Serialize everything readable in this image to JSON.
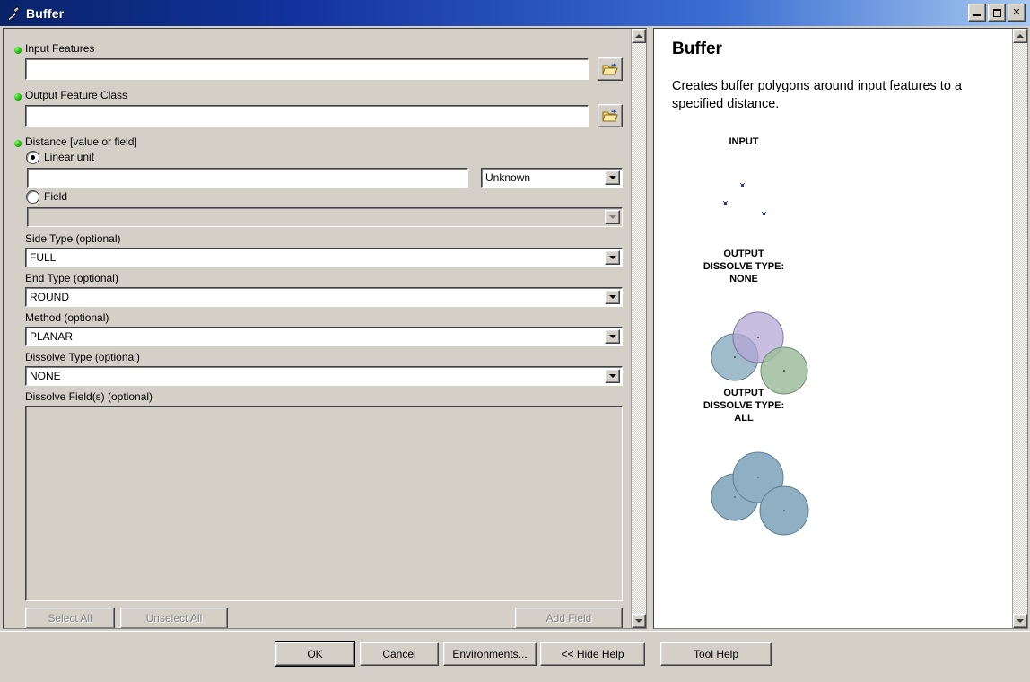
{
  "window": {
    "title": "Buffer",
    "icon": "hammer-tool-icon",
    "minimize_label": "Minimize",
    "maximize_label": "Maximize",
    "close_label": "✕"
  },
  "parameters": {
    "input_features": {
      "label": "Input Features",
      "value": "",
      "required": true,
      "browse_label": "Browse"
    },
    "output_feature_class": {
      "label": "Output Feature Class",
      "value": "",
      "required": true,
      "browse_label": "Browse"
    },
    "distance": {
      "label": "Distance [value or field]",
      "required": true,
      "linear_unit_option": "Linear unit",
      "linear_unit_value": "",
      "unit_value": "Unknown",
      "field_option": "Field",
      "field_value": ""
    },
    "side_type": {
      "label": "Side Type (optional)",
      "value": "FULL"
    },
    "end_type": {
      "label": "End Type (optional)",
      "value": "ROUND"
    },
    "method": {
      "label": "Method (optional)",
      "value": "PLANAR"
    },
    "dissolve_type": {
      "label": "Dissolve Type (optional)",
      "value": "NONE"
    },
    "dissolve_fields": {
      "label": "Dissolve Field(s) (optional)",
      "items": []
    }
  },
  "field_actions": {
    "select_all": "Select All",
    "unselect_all": "Unselect All",
    "add_field": "Add Field"
  },
  "help": {
    "title": "Buffer",
    "description": "Creates buffer polygons around input features to a specified distance.",
    "diagrams": [
      {
        "caption": "INPUT",
        "type": "points"
      },
      {
        "caption": "OUTPUT\nDISSOLVE TYPE:\nNONE",
        "type": "buffers-none"
      },
      {
        "caption": "OUTPUT\nDISSOLVE TYPE:\nALL",
        "type": "buffers-all"
      }
    ]
  },
  "footer": {
    "ok": "OK",
    "cancel": "Cancel",
    "environments": "Environments...",
    "hide_help": "<< Hide Help",
    "tool_help": "Tool Help"
  },
  "colors": {
    "titlebar_start": "#0a246a",
    "titlebar_end": "#a6c8f0",
    "dialog_face": "#d4d0c8",
    "required_dot": "#0ea500",
    "buffer_purple": "#b3a6d4",
    "buffer_blue": "#94b0c4",
    "buffer_green": "#9dbd9d",
    "point_marker": "#2a3a8c"
  }
}
